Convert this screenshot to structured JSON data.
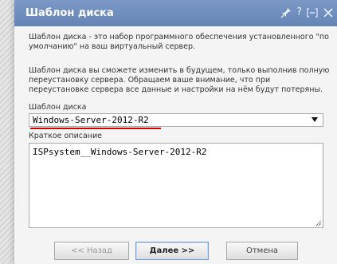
{
  "dialog": {
    "title": "Шаблон диска",
    "titlebar_icons": [
      "pin-icon",
      "help-icon",
      "minimize-icon",
      "close-icon"
    ],
    "help_glyph": "?"
  },
  "content": {
    "paragraph1": "Шаблон диска - это набор программного обеспечения установленного \"по умолчанию\" на ваш виртуальный сервер.",
    "paragraph2": "Шаблон диска вы сможете изменить в будущем, только выполнив полную переустановку сервера. Обращаем ваше внимание, что при переустановке сервера все данные и настройки на нём будут потеряны."
  },
  "form": {
    "template_label": "Шаблон диска",
    "template_value": "Windows-Server-2012-R2",
    "description_label": "Краткое описание",
    "description_value": "ISPsystem__Windows-Server-2012-R2"
  },
  "buttons": {
    "back": "<< Назад",
    "next": "Далее >>",
    "cancel": "Отмена"
  },
  "colors": {
    "titlebar": "#6f8dbf",
    "underline": "#d00000",
    "dialog_bg": "#f4f4f4"
  }
}
